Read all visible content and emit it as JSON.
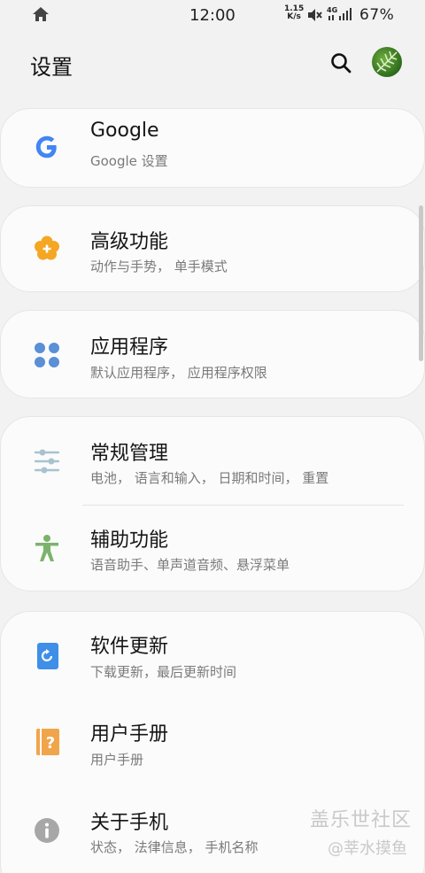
{
  "status_bar": {
    "time": "12:00",
    "net_speed_top": "1.15",
    "net_speed_bottom": "K/s",
    "network_type": "4G",
    "battery": "67%"
  },
  "header": {
    "title": "设置"
  },
  "items": [
    {
      "label": "Google",
      "sub": "Google 设置",
      "icon": "google-icon",
      "color": "#4285f4"
    },
    {
      "label": "高级功能",
      "sub": "动作与手势， 单手模式",
      "icon": "advanced-features-icon",
      "color": "#f5a623"
    },
    {
      "label": "应用程序",
      "sub": "默认应用程序， 应用程序权限",
      "icon": "apps-icon",
      "color": "#5b8fd6"
    },
    {
      "label": "常规管理",
      "sub": "电池， 语言和输入， 日期和时间， 重置",
      "icon": "general-management-icon",
      "color": "#8fb4c2"
    },
    {
      "label": "辅助功能",
      "sub": "语音助手、单声道音频、悬浮菜单",
      "icon": "accessibility-icon",
      "color": "#7bb36b"
    },
    {
      "label": "软件更新",
      "sub": "下载更新，最后更新时间",
      "icon": "software-update-icon",
      "color": "#3f8ee8"
    },
    {
      "label": "用户手册",
      "sub": "用户手册",
      "icon": "user-manual-icon",
      "color": "#f0a54b"
    },
    {
      "label": "关于手机",
      "sub": "状态， 法律信息， 手机名称",
      "icon": "about-phone-icon",
      "color": "#a7a7a7"
    }
  ],
  "watermark": {
    "line1": "盖乐世社区",
    "line2": "@莘水摸鱼"
  }
}
